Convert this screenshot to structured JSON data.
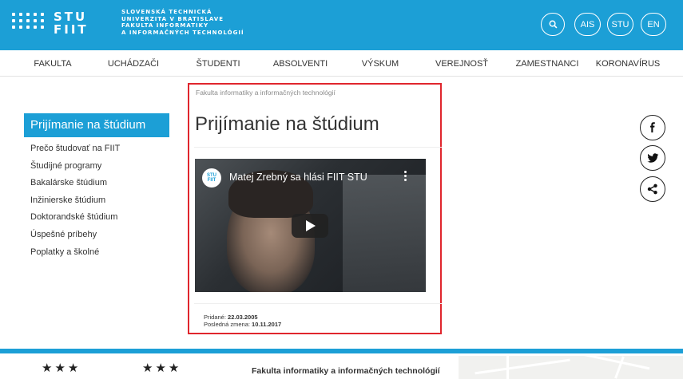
{
  "header": {
    "logo_line1": "STU",
    "logo_line2": "FIIT",
    "university_lines": [
      "SLOVENSKÁ TECHNICKÁ",
      "UNIVERZITA V BRATISLAVE",
      "FAKULTA INFORMATIKY",
      "A INFORMAČNÝCH TECHNOLÓGIÍ"
    ],
    "buttons": {
      "ais": "AIS",
      "stu": "STU",
      "en": "EN"
    },
    "search_icon": "search-icon",
    "brand_color": "#1c9fd6"
  },
  "nav": {
    "items": [
      "FAKULTA",
      "UCHÁDZAČI",
      "ŠTUDENTI",
      "ABSOLVENTI",
      "VÝSKUM",
      "VEREJNOSŤ",
      "ZAMESTNANCI",
      "KORONAVÍRUS"
    ]
  },
  "sidebar": {
    "title": "Prijímanie na štúdium",
    "items": [
      "Prečo študovať na FIIT",
      "Študijné programy",
      "Bakalárske štúdium",
      "Inžinierske štúdium",
      "Doktorandské štúdium",
      "Úspešné príbehy",
      "Poplatky a školné"
    ]
  },
  "main": {
    "breadcrumb": "Fakulta informatiky a informačných technológií",
    "title": "Prijímanie na štúdium",
    "video": {
      "title": "Matej Zrebný sa hlási FIIT STU",
      "channel_logo_line1": "STU",
      "channel_logo_line2": "FIIT"
    },
    "added_label": "Pridané:",
    "added_date": "22.03.2005",
    "modified_label": "Posledná zmena:",
    "modified_date": "10.11.2017",
    "highlight_color": "#e0262d"
  },
  "social": [
    "facebook-icon",
    "twitter-icon",
    "share-icon"
  ],
  "footer": {
    "stars_left": "★★★",
    "stars_right": "★★★",
    "title": "Fakulta informatiky a informačných technológií"
  }
}
